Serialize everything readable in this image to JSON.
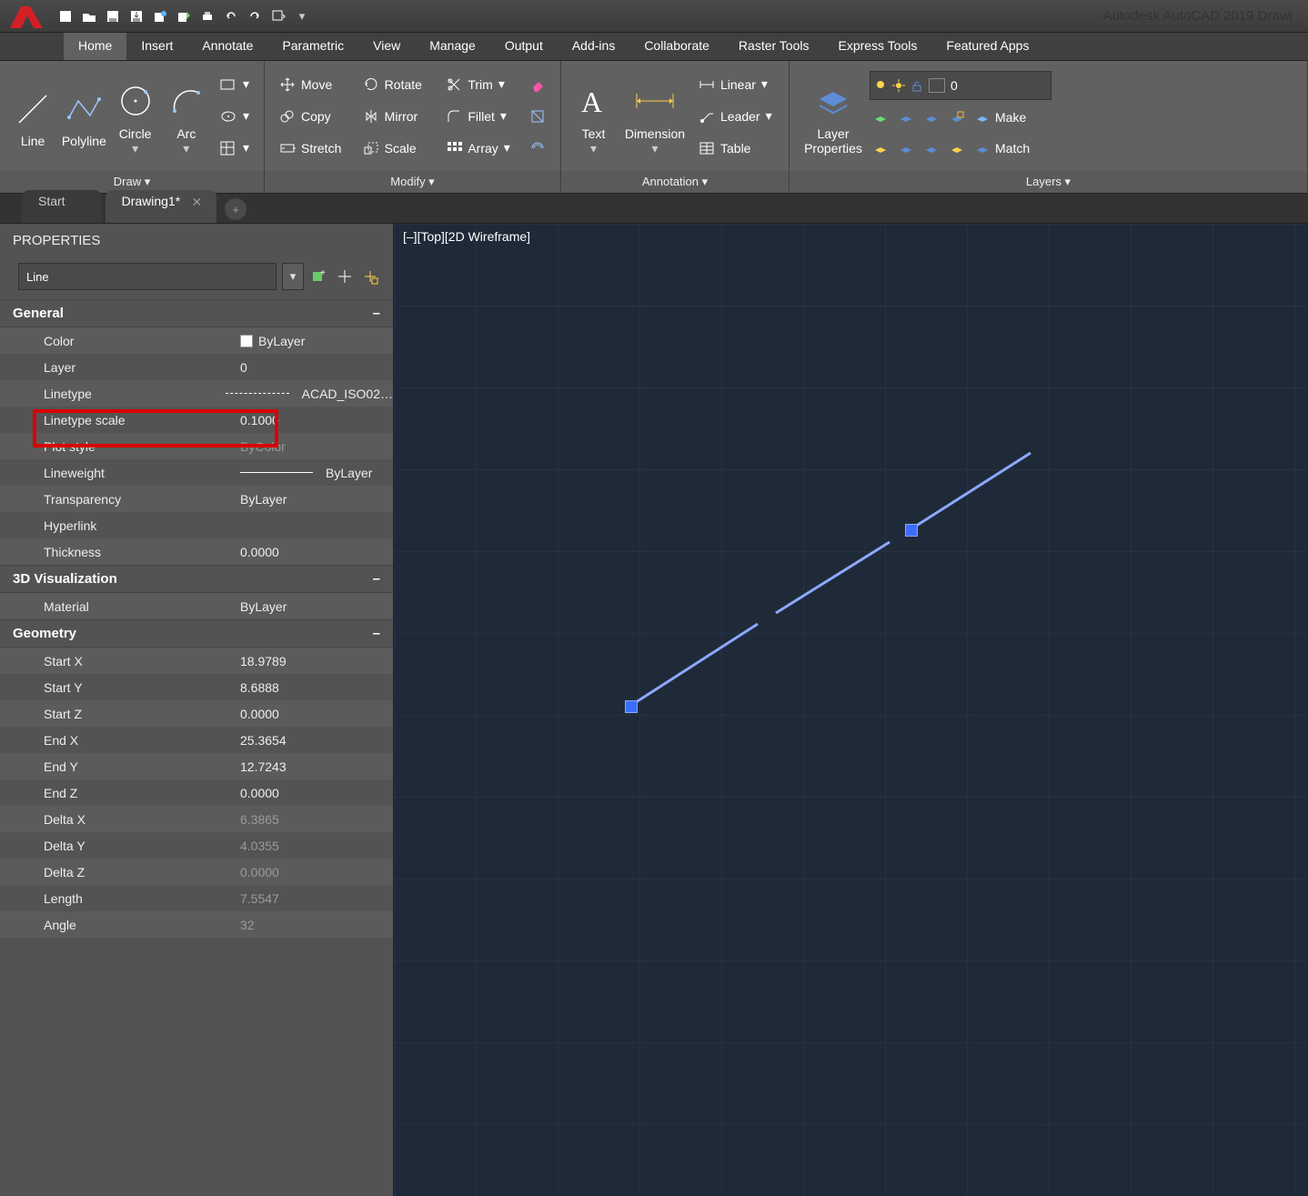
{
  "titlebar": {
    "app_title": "Autodesk AutoCAD 2019   Drawi"
  },
  "tabs": {
    "home": "Home",
    "insert": "Insert",
    "annotate": "Annotate",
    "parametric": "Parametric",
    "view": "View",
    "manage": "Manage",
    "output": "Output",
    "addins": "Add-ins",
    "collaborate": "Collaborate",
    "raster": "Raster Tools",
    "express": "Express Tools",
    "featured": "Featured Apps"
  },
  "ribbon": {
    "draw": {
      "title": "Draw ▾",
      "line": "Line",
      "polyline": "Polyline",
      "circle": "Circle",
      "arc": "Arc"
    },
    "modify": {
      "title": "Modify ▾",
      "move": "Move",
      "rotate": "Rotate",
      "trim": "Trim",
      "copy": "Copy",
      "mirror": "Mirror",
      "fillet": "Fillet",
      "stretch": "Stretch",
      "scale": "Scale",
      "array": "Array"
    },
    "annotation": {
      "title": "Annotation ▾",
      "text": "Text",
      "dimension": "Dimension",
      "linear": "Linear",
      "leader": "Leader",
      "table": "Table"
    },
    "layers": {
      "title": "Layers ▾",
      "props": "Layer\nProperties",
      "current": "0",
      "make": "Make",
      "match": "Match"
    }
  },
  "doctabs": {
    "start": "Start",
    "drawing": "Drawing1*"
  },
  "viewport_label": "[–][Top][2D Wireframe]",
  "props": {
    "palette_title": "PROPERTIES",
    "selection": "Line",
    "groups": {
      "general": "General",
      "viz": "3D Visualization",
      "geom": "Geometry"
    },
    "labels": {
      "color": "Color",
      "layer": "Layer",
      "linetype": "Linetype",
      "ltscale": "Linetype scale",
      "plotstyle": "Plot style",
      "lineweight": "Lineweight",
      "transparency": "Transparency",
      "hyperlink": "Hyperlink",
      "thickness": "Thickness",
      "material": "Material",
      "startx": "Start X",
      "starty": "Start Y",
      "startz": "Start Z",
      "endx": "End X",
      "endy": "End Y",
      "endz": "End Z",
      "dx": "Delta X",
      "dy": "Delta Y",
      "dz": "Delta Z",
      "length": "Length",
      "angle": "Angle"
    },
    "values": {
      "color": "ByLayer",
      "layer": "0",
      "linetype": "ACAD_ISO02…",
      "ltscale": "0.1000",
      "plotstyle": "ByColor",
      "lineweight": "ByLayer",
      "transparency": "ByLayer",
      "hyperlink": "",
      "thickness": "0.0000",
      "material": "ByLayer",
      "startx": "18.9789",
      "starty": "8.6888",
      "startz": "0.0000",
      "endx": "25.3654",
      "endy": "12.7243",
      "endz": "0.0000",
      "dx": "6.3865",
      "dy": "4.0355",
      "dz": "0.0000",
      "length": "7.5547",
      "angle": "32"
    }
  }
}
